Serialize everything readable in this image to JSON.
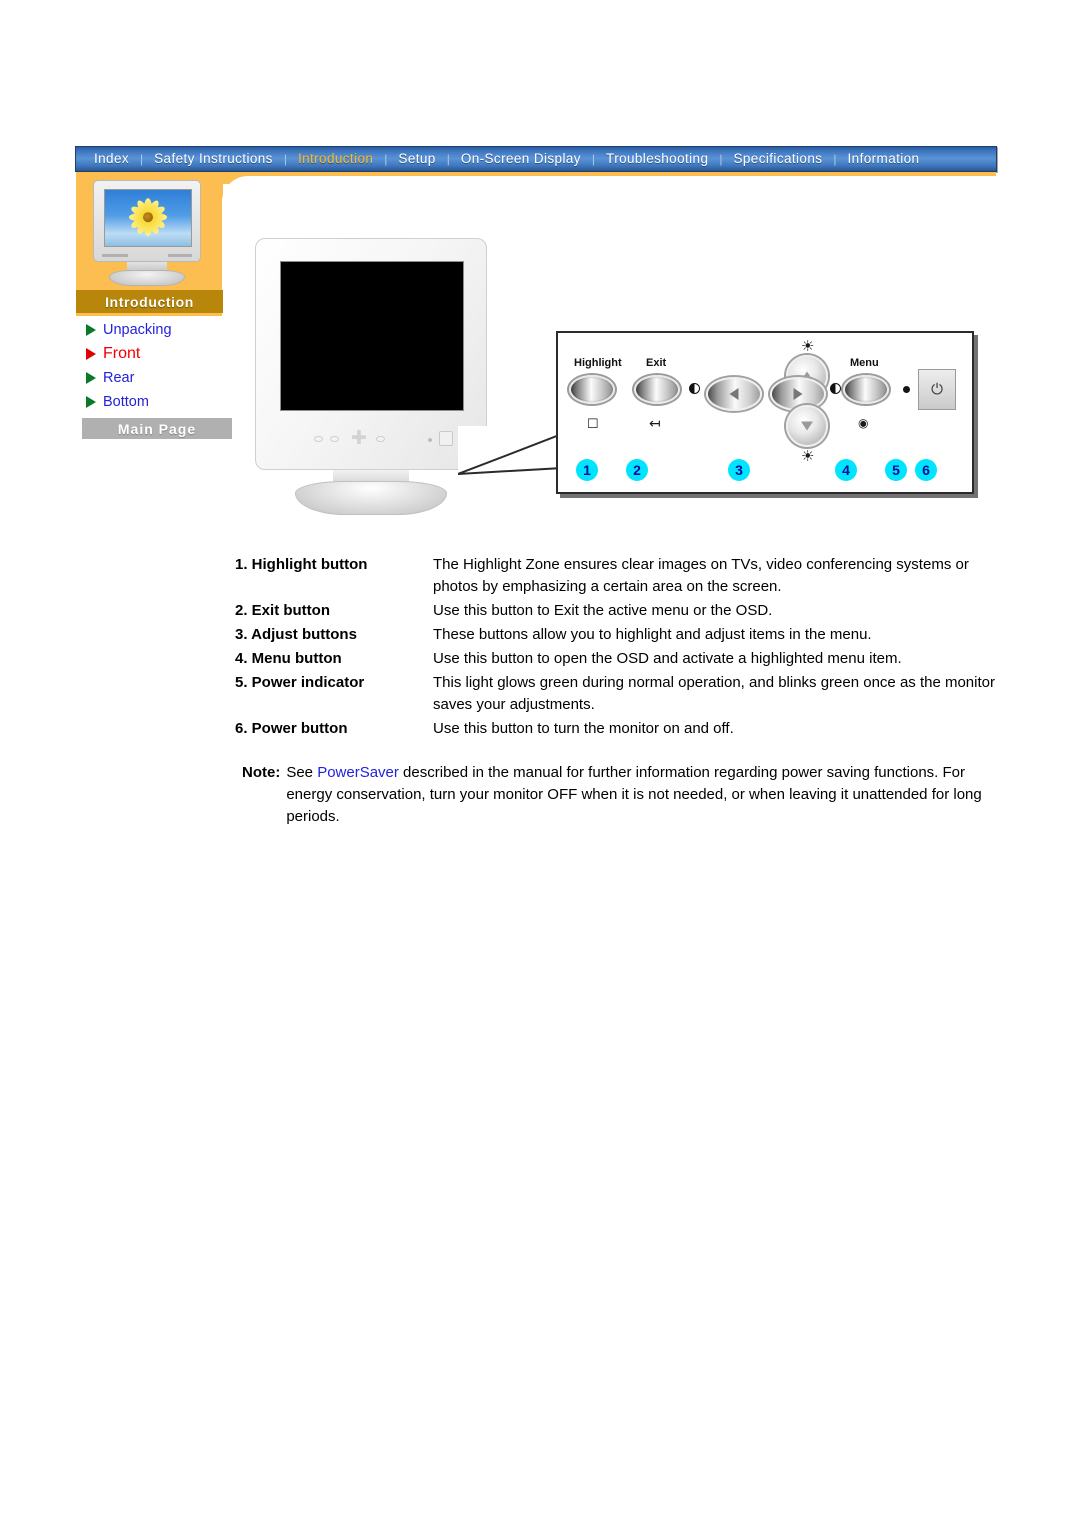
{
  "nav": {
    "items": [
      {
        "label": "Index",
        "active": false
      },
      {
        "label": "Safety Instructions",
        "active": false
      },
      {
        "label": "Introduction",
        "active": true
      },
      {
        "label": "Setup",
        "active": false
      },
      {
        "label": "On-Screen Display",
        "active": false
      },
      {
        "label": "Troubleshooting",
        "active": false
      },
      {
        "label": "Specifications",
        "active": false
      },
      {
        "label": "Information",
        "active": false
      }
    ],
    "separator": "|"
  },
  "sidebar": {
    "section_title": "Introduction",
    "links": [
      {
        "label": "Unpacking",
        "current": false
      },
      {
        "label": "Front",
        "current": true
      },
      {
        "label": "Rear",
        "current": false
      },
      {
        "label": "Bottom",
        "current": false
      }
    ],
    "main_page_button": "Main Page"
  },
  "figure": {
    "panel_labels": {
      "highlight": "Highlight",
      "exit": "Exit",
      "menu": "Menu"
    },
    "badges": [
      "1",
      "2",
      "3",
      "4",
      "5",
      "6"
    ],
    "power_glyph": "⏻"
  },
  "descriptions": [
    {
      "term": "1. Highlight button",
      "definition": "The Highlight Zone ensures clear images on TVs, video conferencing systems or photos by emphasizing a certain area on the screen."
    },
    {
      "term": "2. Exit button",
      "definition": "Use this button to Exit the active menu or the OSD."
    },
    {
      "term": "3. Adjust buttons",
      "definition": "These buttons allow you to highlight and adjust items in the menu."
    },
    {
      "term": "4. Menu button",
      "definition": "Use this button to open the OSD and activate a highlighted menu item."
    },
    {
      "term": "5. Power indicator",
      "definition": "This light glows green during normal operation, and blinks green once as the monitor saves your adjustments."
    },
    {
      "term": "6. Power button",
      "definition": "Use this button to turn the monitor on and off."
    }
  ],
  "note": {
    "label": "Note:",
    "text_before": "See ",
    "link": "PowerSaver",
    "text_after": " described in the manual for further information regarding power saving functions. For energy conservation, turn your monitor OFF when it is not needed, or when leaving it unattended for long periods."
  },
  "colors": {
    "nav_blue": "#3f78c0",
    "nav_active": "#ffbb22",
    "sidebar_orange": "#fcbe50",
    "section_gold": "#b8860b",
    "link_blue": "#2222dd",
    "current_red": "#f00000",
    "badge_cyan": "#00e5ff",
    "badge_text": "#000e9c",
    "main_page_gray": "#b0b0b0"
  }
}
